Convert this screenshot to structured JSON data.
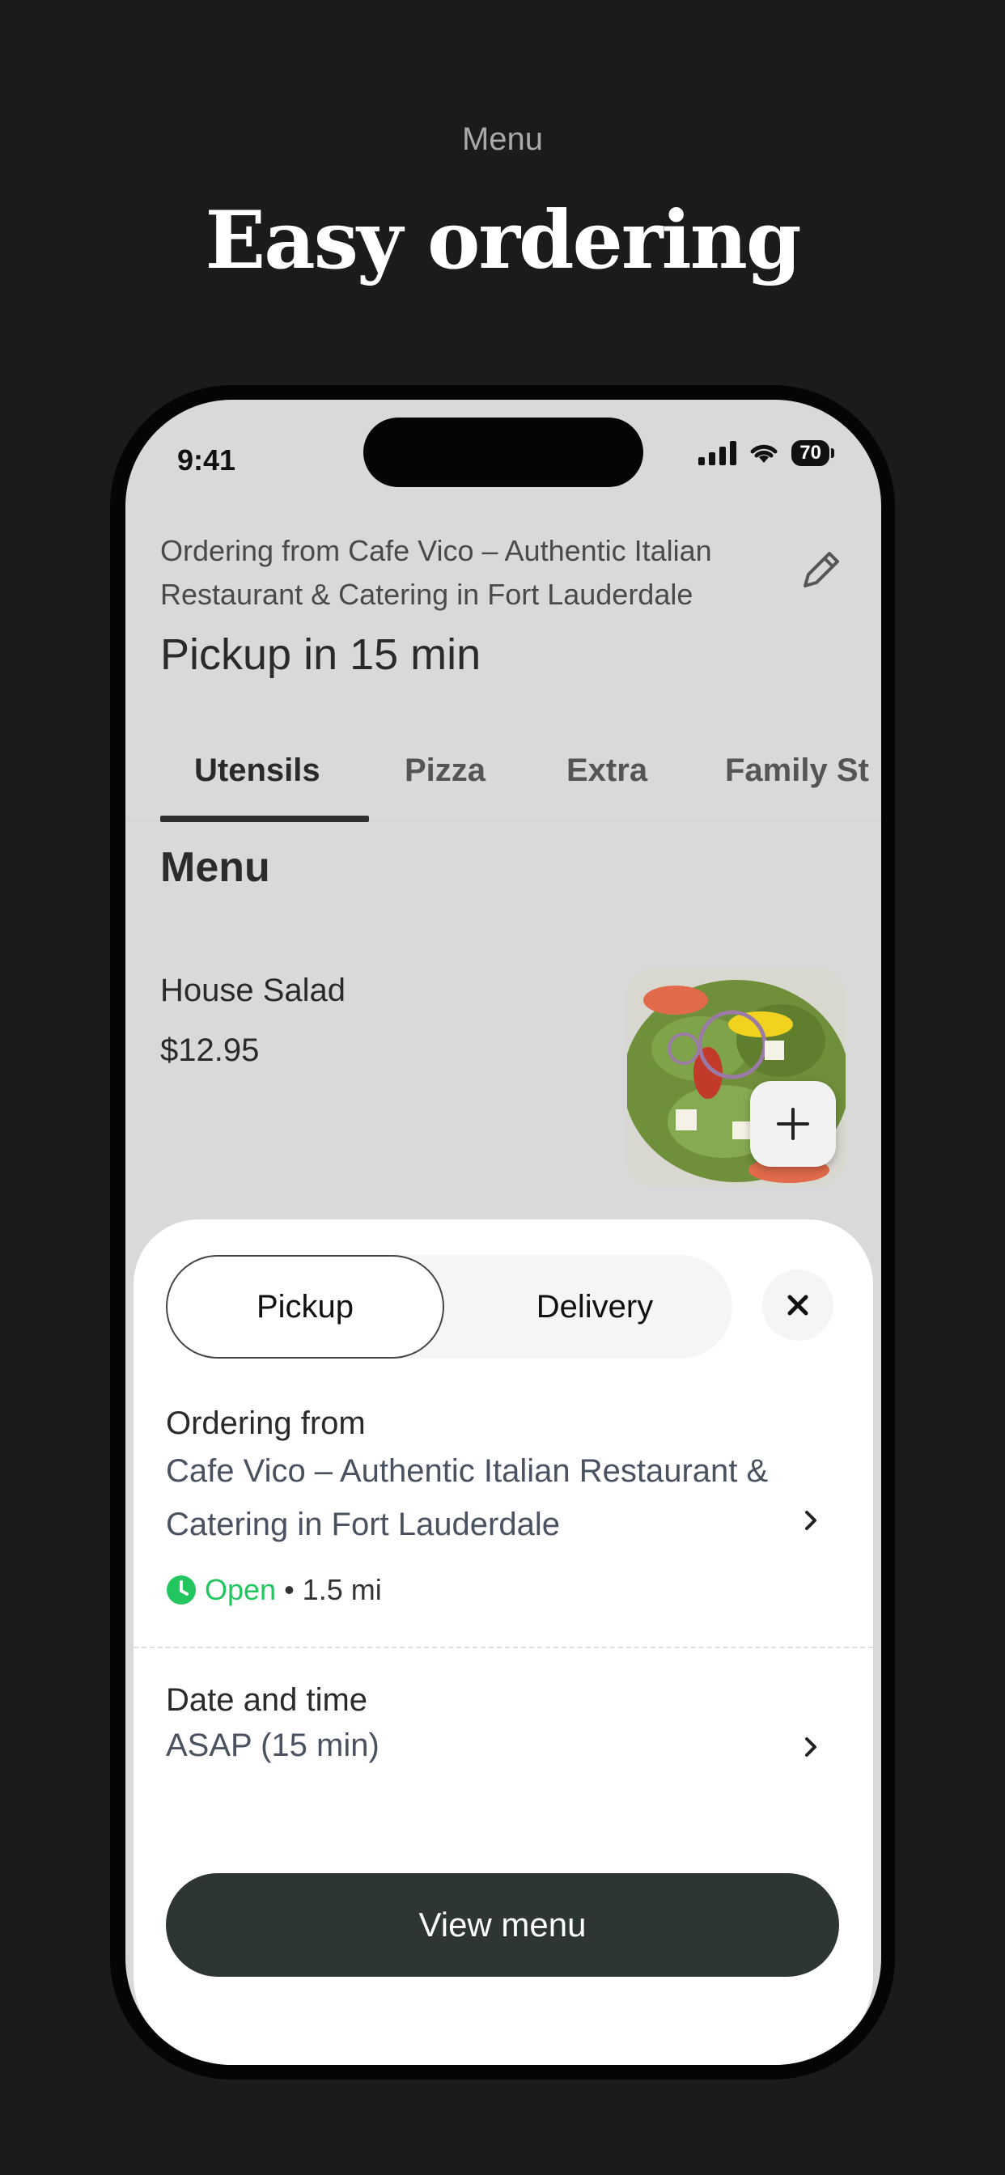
{
  "promo": {
    "eyebrow": "Menu",
    "headline": "Easy ordering"
  },
  "status_bar": {
    "time": "9:41",
    "battery": "70"
  },
  "header": {
    "ordering_from": "Ordering from Cafe Vico – Authentic Italian Restaurant & Catering in Fort Lauderdale",
    "pickup_title": "Pickup in 15 min",
    "edit_icon": "pencil-icon"
  },
  "tabs": [
    {
      "label": "Utensils",
      "active": true
    },
    {
      "label": "Pizza",
      "active": false
    },
    {
      "label": "Extra",
      "active": false
    },
    {
      "label": "Family St",
      "active": false
    }
  ],
  "menu": {
    "section_title": "Menu",
    "items": [
      {
        "name": "House Salad",
        "price": "$12.95",
        "add_icon": "plus-icon"
      }
    ]
  },
  "sheet": {
    "segment": {
      "pickup": "Pickup",
      "delivery": "Delivery",
      "selected": "Pickup"
    },
    "close_icon": "close-icon",
    "ordering_from": {
      "label": "Ordering from",
      "value": "Cafe Vico – Authentic Italian Restaurant & Catering in Fort Lauderdale",
      "status": "Open",
      "status_color": "#22c55e",
      "distance": "• 1.5 mi"
    },
    "date_time": {
      "label": "Date and time",
      "value": "ASAP (15 min)"
    },
    "cta": "View menu"
  },
  "colors": {
    "background": "#1b1b1b",
    "cta": "#2e3535",
    "open": "#22c55e"
  }
}
